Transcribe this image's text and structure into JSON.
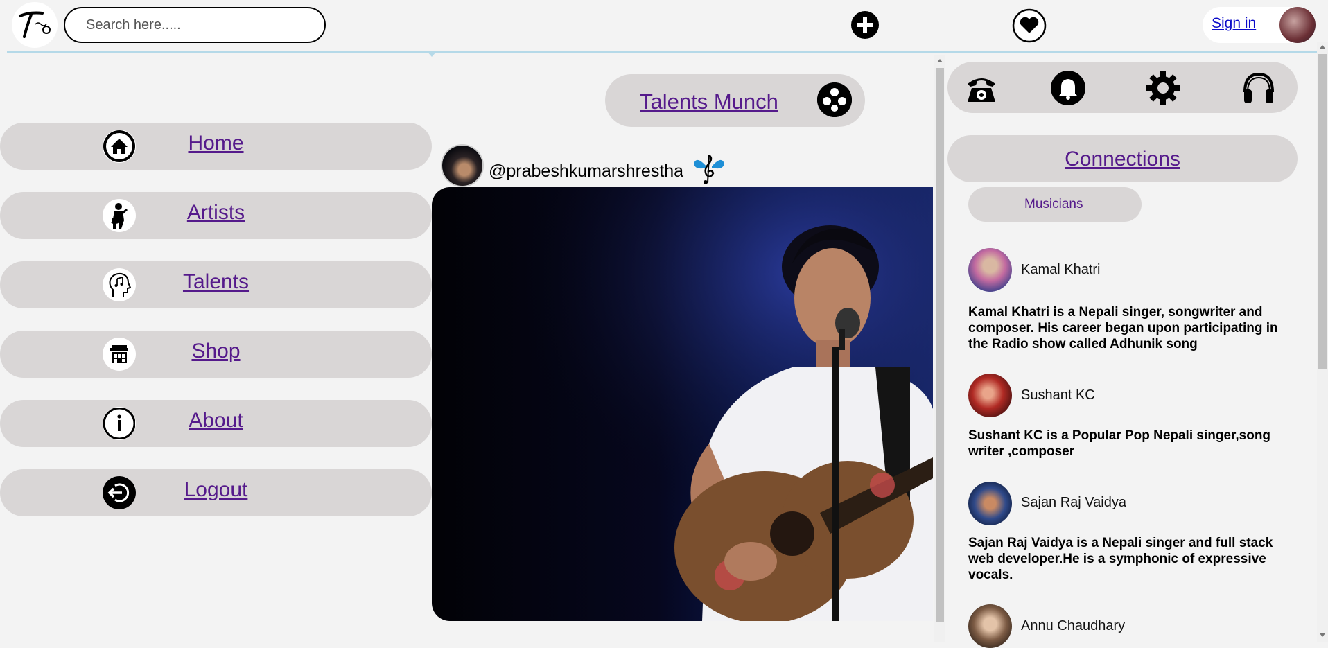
{
  "header": {
    "search_placeholder": "Search here.....",
    "sign_in": "Sign in",
    "icons": [
      "logo-icon",
      "plus-circle-icon",
      "heart-icon",
      "profile-avatar"
    ]
  },
  "nav": {
    "items": [
      {
        "label": "Home",
        "icon": "home-icon"
      },
      {
        "label": "Artists",
        "icon": "guitarist-icon"
      },
      {
        "label": "Talents",
        "icon": "head-music-icon"
      },
      {
        "label": "Shop",
        "icon": "shop-icon"
      },
      {
        "label": "About",
        "icon": "info-icon"
      },
      {
        "label": "Logout",
        "icon": "logout-icon"
      }
    ]
  },
  "feed": {
    "section_label": "Talents Munch",
    "post": {
      "username": "@prabeshkumarshrestha"
    }
  },
  "right": {
    "icons": [
      "telephone-icon",
      "bell-icon",
      "gear-icon",
      "headphones-icon"
    ],
    "connections_label": "Connections",
    "filter_label": "Musicians",
    "connections": [
      {
        "name": "Kamal Khatri",
        "desc": "Kamal Khatri is a Nepali singer, songwriter and composer. His career began upon participating in the Radio show called Adhunik song"
      },
      {
        "name": "Sushant KC",
        "desc": "Sushant KC is a Popular Pop Nepali singer,song writer ,composer"
      },
      {
        "name": "Sajan Raj Vaidya",
        "desc": "Sajan Raj Vaidya is a Nepali singer and full stack web developer.He is a symphonic of expressive vocals."
      },
      {
        "name": "Annu Chaudhary",
        "desc": ""
      }
    ]
  },
  "colors": {
    "pill": "#d9d6d6",
    "link": "#551a8b",
    "background": "#f3f3f3",
    "header_line": "#b5d9e8"
  }
}
